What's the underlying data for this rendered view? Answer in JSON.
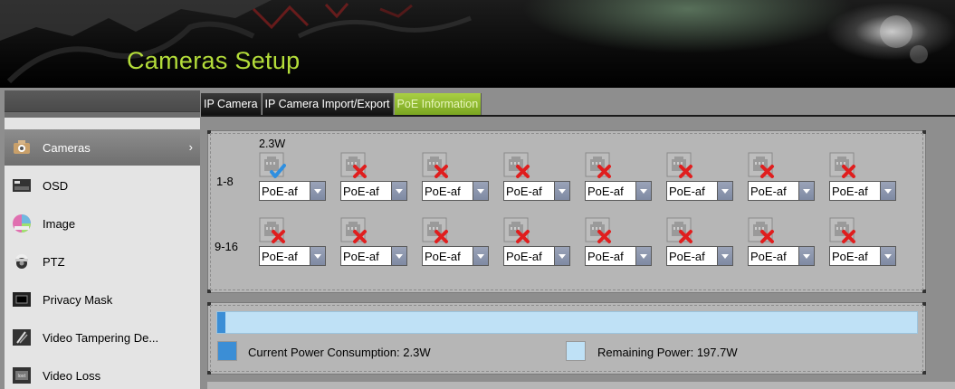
{
  "header": {
    "title": "Cameras Setup"
  },
  "tabs": [
    {
      "label": "IP Camera",
      "active": false
    },
    {
      "label": "IP Camera Import/Export",
      "active": false
    },
    {
      "label": "PoE Information",
      "active": true
    }
  ],
  "sidebar": {
    "items": [
      {
        "label": "Cameras",
        "icon": "camera-icon",
        "active": true
      },
      {
        "label": "OSD",
        "icon": "osd-icon",
        "active": false
      },
      {
        "label": "Image",
        "icon": "image-color-icon",
        "active": false
      },
      {
        "label": "PTZ",
        "icon": "ptz-camera-icon",
        "active": false
      },
      {
        "label": "Privacy Mask",
        "icon": "privacy-mask-icon",
        "active": false
      },
      {
        "label": "Video Tampering De...",
        "icon": "video-tampering-icon",
        "active": false
      },
      {
        "label": "Video Loss",
        "icon": "video-loss-icon",
        "active": false
      }
    ],
    "arrow": "›"
  },
  "poe": {
    "power_label": "2.3W",
    "rows": [
      {
        "label": "1-8",
        "ports": [
          {
            "status": "connected",
            "mode": "PoE-af"
          },
          {
            "status": "disconnected",
            "mode": "PoE-af"
          },
          {
            "status": "disconnected",
            "mode": "PoE-af"
          },
          {
            "status": "disconnected",
            "mode": "PoE-af"
          },
          {
            "status": "disconnected",
            "mode": "PoE-af"
          },
          {
            "status": "disconnected",
            "mode": "PoE-af"
          },
          {
            "status": "disconnected",
            "mode": "PoE-af"
          },
          {
            "status": "disconnected",
            "mode": "PoE-af"
          }
        ]
      },
      {
        "label": "9-16",
        "ports": [
          {
            "status": "disconnected",
            "mode": "PoE-af"
          },
          {
            "status": "disconnected",
            "mode": "PoE-af"
          },
          {
            "status": "disconnected",
            "mode": "PoE-af"
          },
          {
            "status": "disconnected",
            "mode": "PoE-af"
          },
          {
            "status": "disconnected",
            "mode": "PoE-af"
          },
          {
            "status": "disconnected",
            "mode": "PoE-af"
          },
          {
            "status": "disconnected",
            "mode": "PoE-af"
          },
          {
            "status": "disconnected",
            "mode": "PoE-af"
          }
        ]
      }
    ]
  },
  "power": {
    "used_fraction": 0.0115,
    "current_label": "Current Power Consumption: 2.3W",
    "remaining_label": "Remaining Power: 197.7W",
    "used_color": "#3b8ed6",
    "remaining_color": "#bfe1f6"
  },
  "colors": {
    "title": "#b4dd3a",
    "active_tab": "#8fbc2c"
  }
}
